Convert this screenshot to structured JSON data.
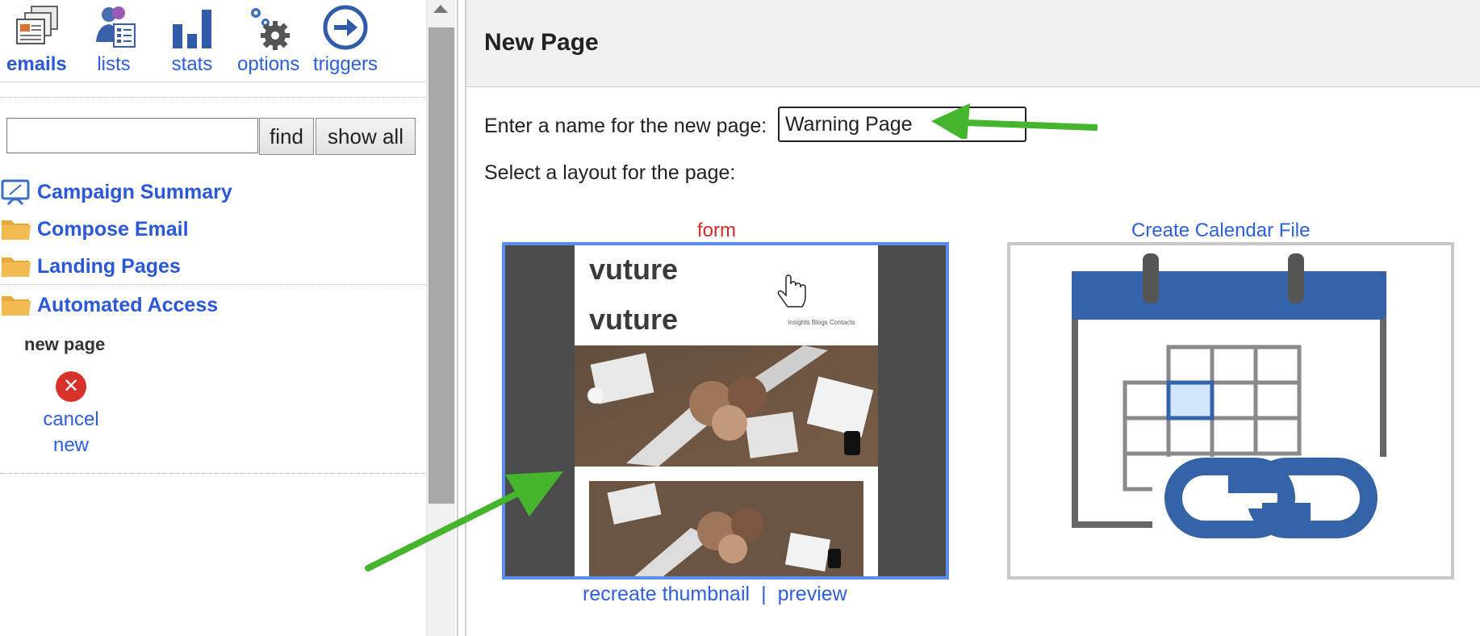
{
  "toolbar": {
    "items": [
      {
        "label": "emails",
        "icon": "emails-icon",
        "active": true
      },
      {
        "label": "lists",
        "icon": "lists-icon"
      },
      {
        "label": "stats",
        "icon": "stats-icon"
      },
      {
        "label": "options",
        "icon": "gear-icon"
      },
      {
        "label": "triggers",
        "icon": "arrow-right-circle-icon"
      }
    ]
  },
  "search": {
    "value": "",
    "find_label": "find",
    "show_all_label": "show all"
  },
  "nav": {
    "items": [
      {
        "label": "Campaign Summary",
        "icon": "monitor-icon"
      },
      {
        "label": "Compose Email",
        "icon": "folder-icon"
      },
      {
        "label": "Landing Pages",
        "icon": "folder-icon"
      },
      {
        "label": "Automated Access",
        "icon": "folder-icon"
      }
    ],
    "sub_heading": "new page",
    "cancel_label": "cancel\nnew"
  },
  "main": {
    "title": "New Page",
    "name_prompt": "Enter a name for the new page:",
    "name_value": "Warning Page",
    "layout_prompt": "Select a layout for the page:",
    "layouts": [
      {
        "title": "form",
        "title_color": "#d42b2b",
        "logo_text": "vuture",
        "logo_text_2": "vuture",
        "nav_text": "Insights  Blogs  Contacts"
      },
      {
        "title": "Create Calendar File",
        "title_color": "#2f5fdd"
      }
    ],
    "recreate_label": "recreate thumbnail",
    "separator": "|",
    "preview_label": "preview"
  },
  "colors": {
    "link": "#2f5fdd",
    "accent_arrow": "#45b52e",
    "calendar_blue": "#3563a8"
  }
}
